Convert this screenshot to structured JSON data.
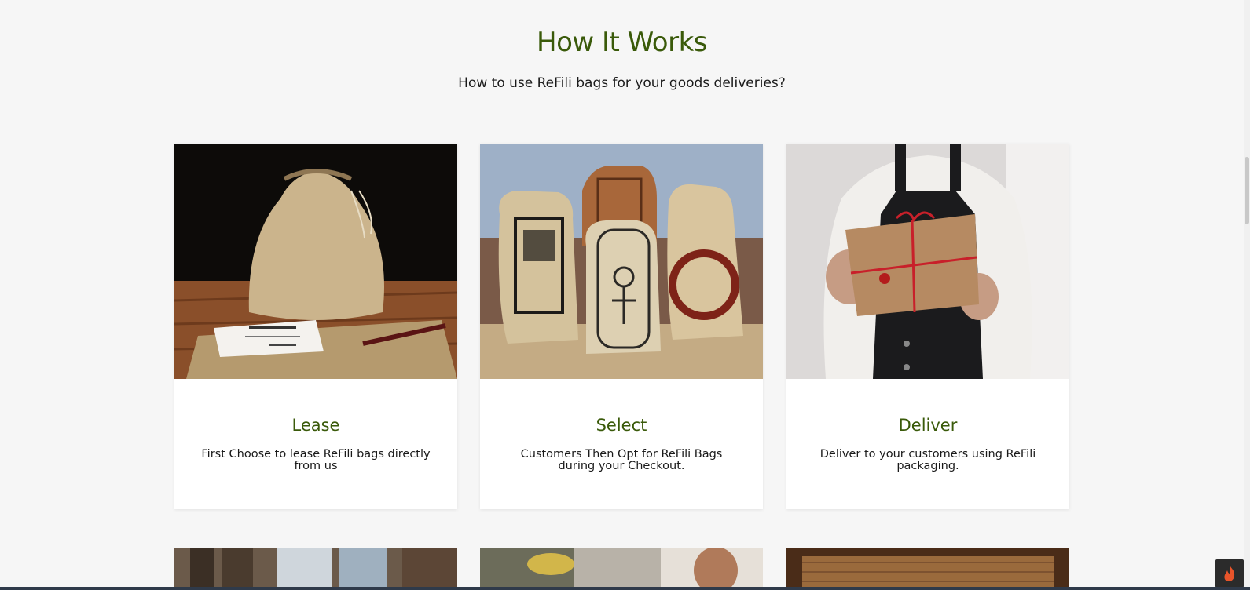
{
  "section": {
    "title": "How It Works",
    "subtitle": "How to use ReFili bags for your goods deliveries?"
  },
  "cards": [
    {
      "title": "Lease",
      "description": "First Choose to lease ReFili bags directly from us",
      "image": "burlap-drawstring-bag-photo"
    },
    {
      "title": "Select",
      "description": "Customers Then Opt for ReFili Bags during your Checkout.",
      "image": "printed-burlap-bags-photo"
    },
    {
      "title": "Deliver",
      "description": "Deliver to your customers using ReFili packaging.",
      "image": "person-holding-gift-box-photo"
    }
  ],
  "more_cards": [
    {
      "image": "workspace-photo"
    },
    {
      "image": "woman-working-photo"
    },
    {
      "image": "burlap-texture-photo"
    }
  ],
  "widget": {
    "icon": "flame-icon",
    "color": "#e8542a"
  },
  "colors": {
    "accent": "#3a5a0a",
    "background": "#f6f6f6"
  }
}
